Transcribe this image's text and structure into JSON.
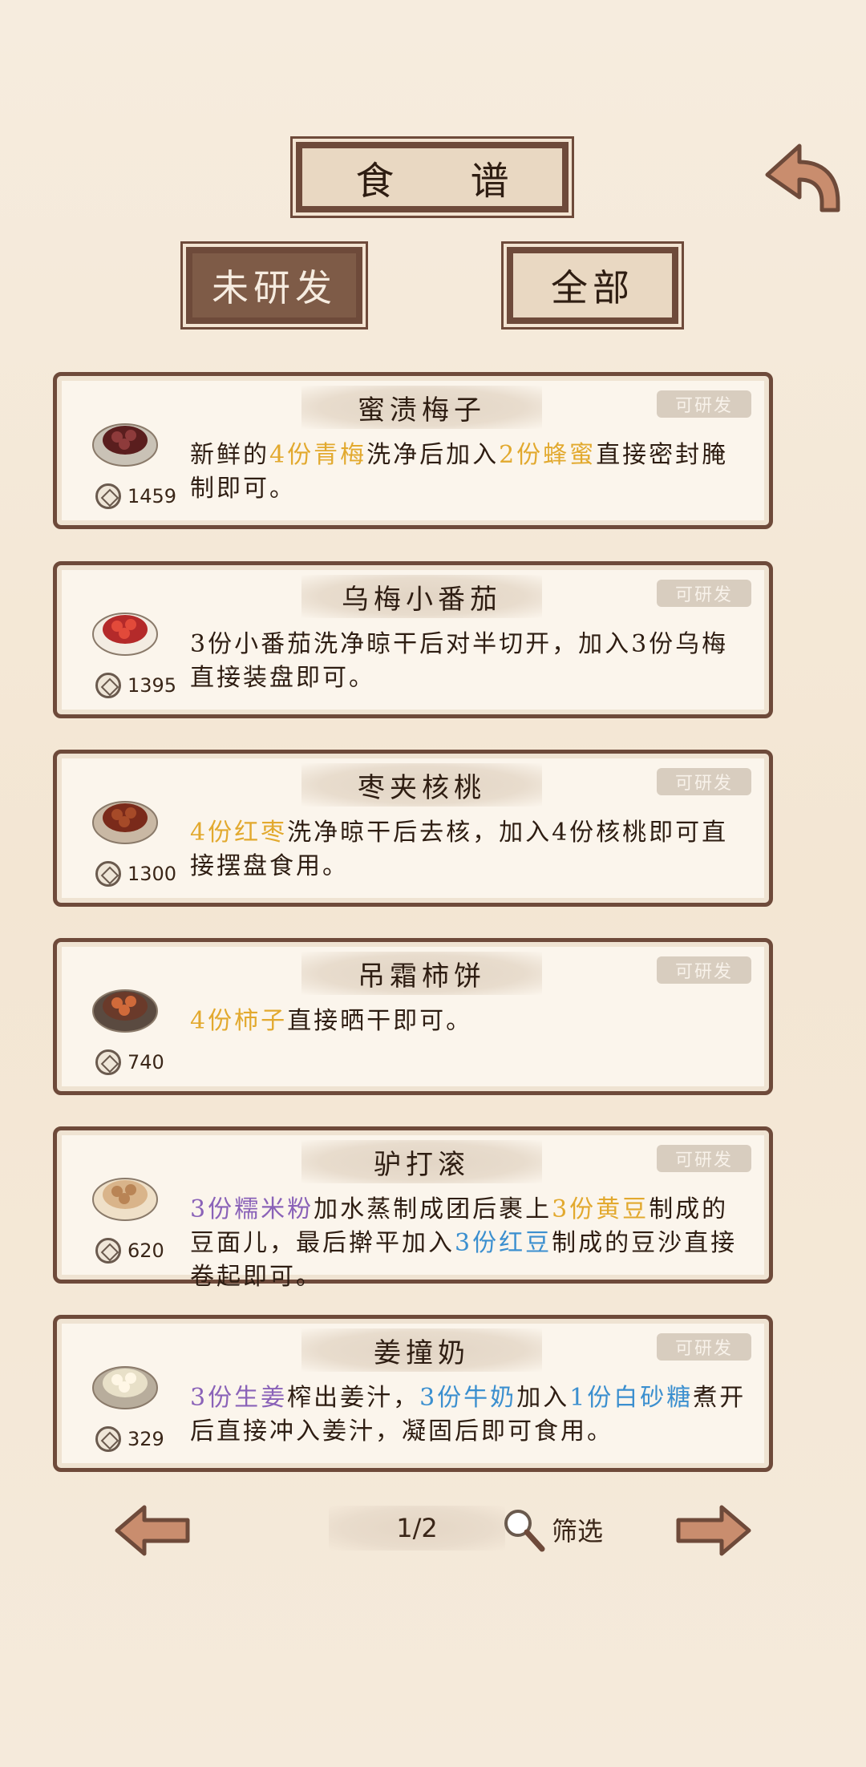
{
  "header": {
    "title": "食 谱"
  },
  "tabs": [
    {
      "label": "未研发"
    },
    {
      "label": "全部"
    }
  ],
  "recipes": [
    {
      "name": "蜜渍梅子",
      "badge": "可研发",
      "price": "1459",
      "desc": [
        {
          "t": "新鲜的",
          "c": ""
        },
        {
          "t": "4份青梅",
          "c": "y"
        },
        {
          "t": "洗净后加入",
          "c": ""
        },
        {
          "t": "2份蜂蜜",
          "c": "y"
        },
        {
          "t": "直接密封腌制即可。",
          "c": ""
        }
      ]
    },
    {
      "name": "乌梅小番茄",
      "badge": "可研发",
      "price": "1395",
      "desc": [
        {
          "t": "3份小番茄洗净晾干后对半切开，加入3份乌梅直接装盘即可。",
          "c": ""
        }
      ]
    },
    {
      "name": "枣夹核桃",
      "badge": "可研发",
      "price": "1300",
      "desc": [
        {
          "t": "4份红枣",
          "c": "y"
        },
        {
          "t": "洗净晾干后去核，加入4份核桃即可直接摆盘食用。",
          "c": ""
        }
      ]
    },
    {
      "name": "吊霜柿饼",
      "badge": "可研发",
      "price": "740",
      "desc": [
        {
          "t": "4份柿子",
          "c": "y"
        },
        {
          "t": "直接晒干即可。",
          "c": ""
        }
      ]
    },
    {
      "name": "驴打滚",
      "badge": "可研发",
      "price": "620",
      "desc": [
        {
          "t": "3份糯米粉",
          "c": "p"
        },
        {
          "t": "加水蒸制成团后裹上",
          "c": ""
        },
        {
          "t": "3份黄豆",
          "c": "y"
        },
        {
          "t": "制成的豆面儿，最后擀平加入",
          "c": ""
        },
        {
          "t": "3份红豆",
          "c": "b"
        },
        {
          "t": "制成的豆沙直接卷起即可。",
          "c": ""
        }
      ]
    },
    {
      "name": "姜撞奶",
      "badge": "可研发",
      "price": "329",
      "desc": [
        {
          "t": "3份生姜",
          "c": "p"
        },
        {
          "t": "榨出姜汁，",
          "c": ""
        },
        {
          "t": "3份牛奶",
          "c": "b"
        },
        {
          "t": "加入",
          "c": ""
        },
        {
          "t": "1份白砂糖",
          "c": "b"
        },
        {
          "t": "煮开后直接冲入姜汁，凝固后即可食用。",
          "c": ""
        }
      ]
    }
  ],
  "pager": {
    "page": "1/2",
    "filter_label": "筛选"
  },
  "icons": {
    "back": "back-arrow-icon",
    "prev": "left-arrow-icon",
    "next": "right-arrow-icon",
    "filter": "magnifier-icon",
    "coin": "coin-icon"
  },
  "colors": {
    "highlight_yellow": "#e2a92e",
    "highlight_purple": "#8a62b8",
    "highlight_blue": "#3b8fcf"
  }
}
